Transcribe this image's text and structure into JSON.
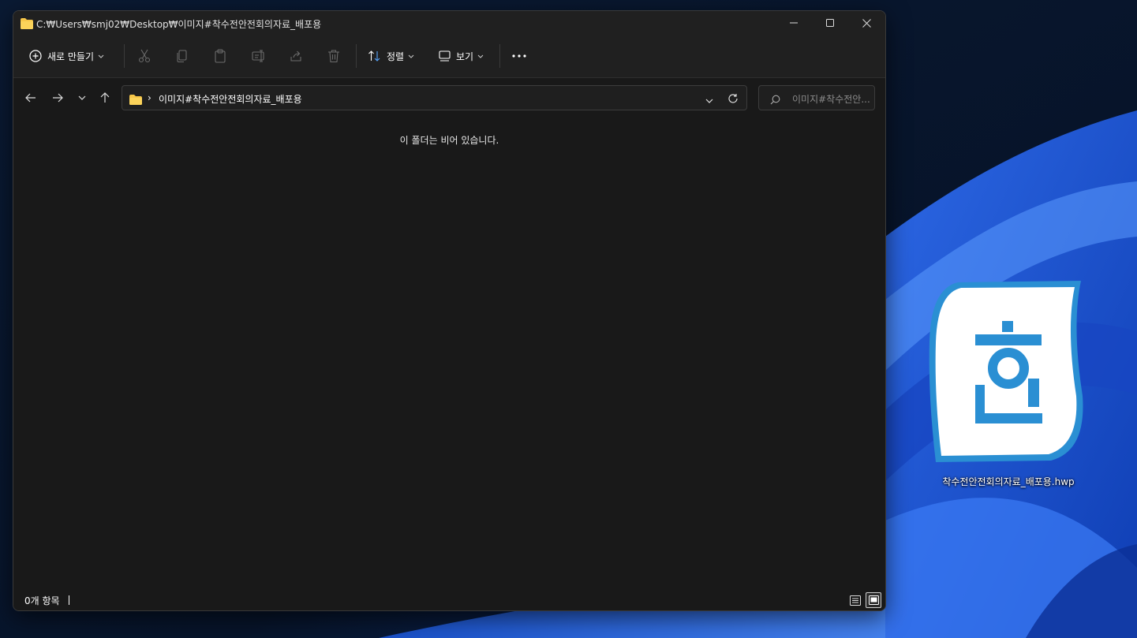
{
  "window": {
    "title": "C:₩Users₩smj02₩Desktop₩이미지#착수전안전회의자료_배포용"
  },
  "toolbar": {
    "new_label": "새로 만들기",
    "sort_label": "정렬",
    "view_label": "보기"
  },
  "address": {
    "path": "이미지#착수전안전회의자료_배포용",
    "search_placeholder": "이미지#착수전안..."
  },
  "content": {
    "empty_message": "이 폴더는 비어 있습니다."
  },
  "status": {
    "item_count": "0개 항목"
  },
  "desktop": {
    "icon_label": "착수전안전회의자료_배포용.hwp",
    "icon_glyph": "한"
  },
  "colors": {
    "accent": "#2b8fd6",
    "folder": "#f6c649",
    "window_bg": "#191919",
    "toolbar_bg": "#202020"
  }
}
